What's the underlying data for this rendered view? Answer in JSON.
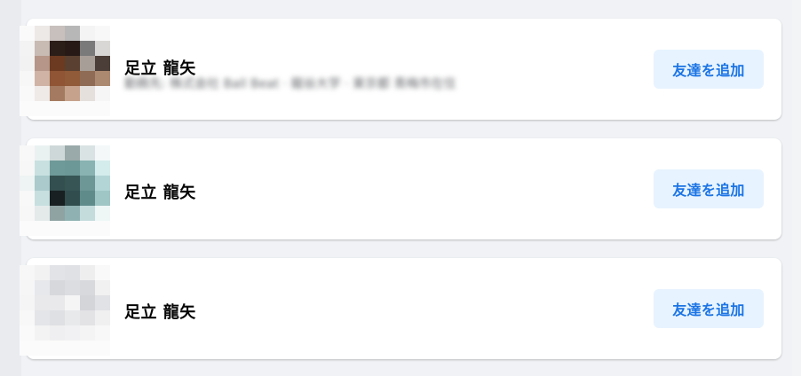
{
  "suggestions": [
    {
      "name": "足立 龍矢",
      "subtext": "勤務先: 株式会社 Ball Beat · 龍谷大学 · 東京都 青梅市在住",
      "button_label": "友達を追加",
      "avatar_colors": [
        "#fafafa",
        "#ece9e6",
        "#c7c0bd",
        "#b7b7b7",
        "#f4f4f4",
        "#f8f8f8",
        "#f3f3f3",
        "#c8bbb3",
        "#2b1d18",
        "#261916",
        "#7a7a7a",
        "#d9d7d5",
        "#f2f2f2",
        "#b59688",
        "#6b3a20",
        "#5a4030",
        "#a89e98",
        "#4b3d37",
        "#f7f7f7",
        "#d0b3a5",
        "#8f5535",
        "#915a38",
        "#8f6b55",
        "#ab8870",
        "#f9f9f9",
        "#efeae7",
        "#a47b60",
        "#c6a28c",
        "#e5e0dc",
        "#f6f6f6"
      ]
    },
    {
      "name": "足立 龍矢",
      "subtext": "",
      "button_label": "友達を追加",
      "avatar_colors": [
        "#f8f8f8",
        "#eaf1f1",
        "#cfd8d8",
        "#9aa9a9",
        "#d9e3e3",
        "#f4f8f8",
        "#f7f7f7",
        "#c9e0e0",
        "#6e9a99",
        "#6c9897",
        "#88b3b2",
        "#d4ecec",
        "#eef3f3",
        "#aacacb",
        "#344f4f",
        "#365554",
        "#6d9696",
        "#b4d5d5",
        "#f8f8f8",
        "#c7dfdf",
        "#182021",
        "#314d4e",
        "#5f8b8b",
        "#9fc5c5",
        "#f7f7f7",
        "#e4eaea",
        "#8fa3a3",
        "#8fb1b1",
        "#c4dcdc",
        "#eef6f6"
      ]
    },
    {
      "name": "足立 龍矢",
      "subtext": "",
      "button_label": "友達を追加",
      "avatar_colors": [
        "#f7f7f7",
        "#f2f2f3",
        "#e2e3e6",
        "#e0e1e4",
        "#eeeeef",
        "#f9f9f9",
        "#f6f6f7",
        "#e7e8eb",
        "#d7d8dc",
        "#dcdde1",
        "#d8d9dd",
        "#f1f1f2",
        "#f5f5f6",
        "#e9e9ec",
        "#e9e9ec",
        "#f5f5f6",
        "#d4d5d9",
        "#e1e2e5",
        "#f8f8f8",
        "#e4e5e8",
        "#dfe0e3",
        "#e8e9eb",
        "#e3e3e6",
        "#f0f0f1",
        "#fafafa",
        "#f3f3f4",
        "#efeff1",
        "#f1f1f3",
        "#f4f4f5",
        "#f8f8f8"
      ]
    }
  ]
}
